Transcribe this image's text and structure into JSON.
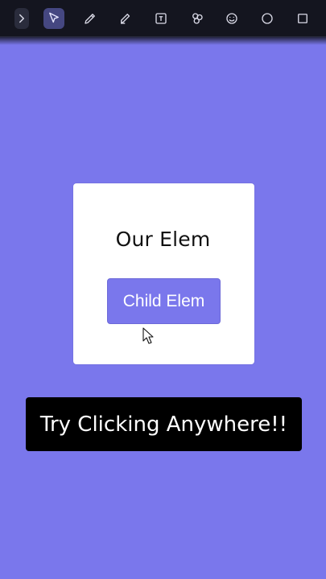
{
  "toolbar": {
    "tools": [
      {
        "icon": "chevron-right-icon"
      },
      {
        "icon": "cursor-select-icon",
        "active": true
      },
      {
        "icon": "pencil-icon"
      },
      {
        "icon": "highlighter-icon"
      },
      {
        "icon": "text-box-icon"
      },
      {
        "icon": "shapes-icon"
      },
      {
        "icon": "emoji-icon"
      },
      {
        "icon": "circle-icon"
      },
      {
        "icon": "square-icon"
      }
    ]
  },
  "card": {
    "title": "Our Elem",
    "button_label": "Child Elem"
  },
  "cta": {
    "label": "Try Clicking Anywhere!!"
  },
  "colors": {
    "background": "#7a77ec",
    "toolbar": "#14151f",
    "card": "#ffffff",
    "cta": "#000000"
  }
}
